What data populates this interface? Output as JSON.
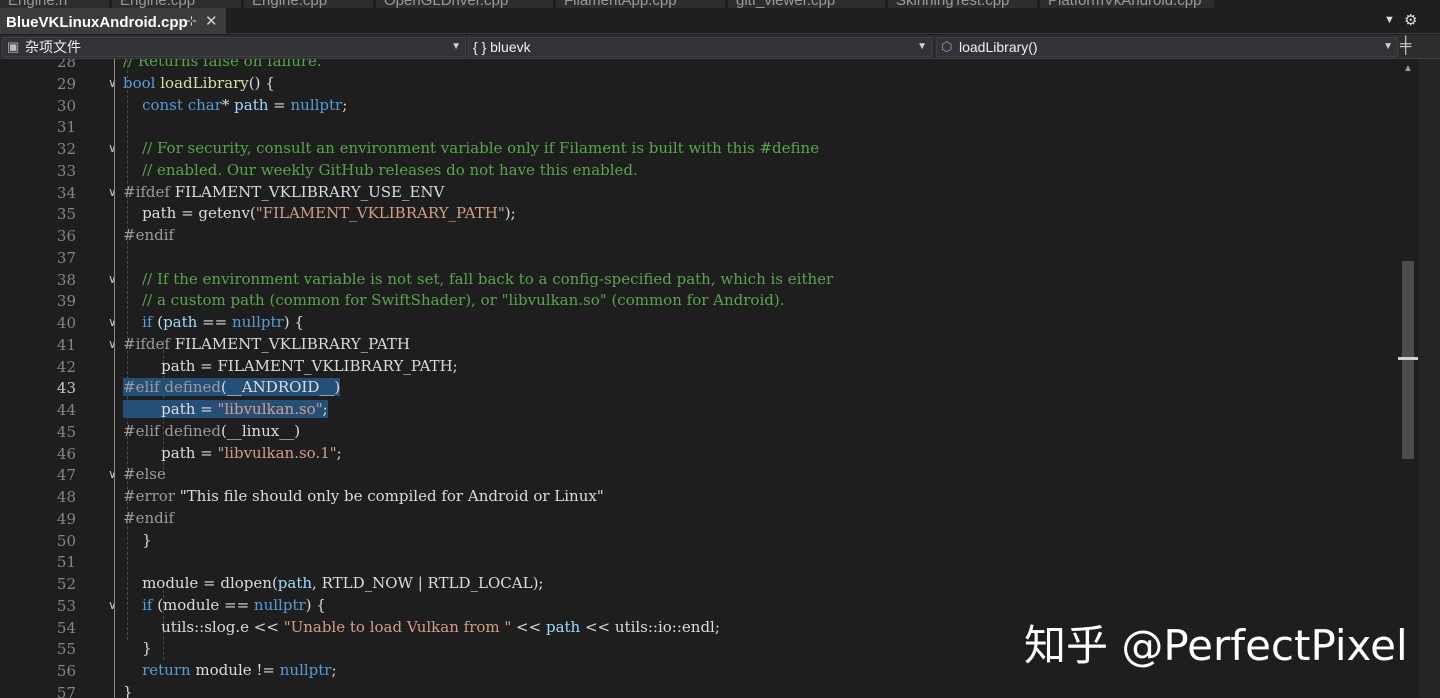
{
  "tabs": {
    "active": {
      "title": "BlueVKLinuxAndroid.cpp",
      "pin": "⊹",
      "close": "✕"
    },
    "inactive": [
      "Engine.h",
      "Engine.cpp",
      "Engine.cpp",
      "OpenGLDriver.cpp",
      "FilamentApp.cpp",
      "gltf_viewer.cpp",
      "SkinningTest.cpp",
      "PlatformVkAndroid.cpp"
    ]
  },
  "navbar": {
    "project": "杂项文件",
    "scope": "{ } bluevk",
    "member": "loadLibrary()"
  },
  "editor": {
    "current_line": 43,
    "lines": [
      {
        "n": "28",
        "html": "<span class='cm'>// Returns false on failure.</span>"
      },
      {
        "n": "29",
        "html": "<span class='kw'>bool</span> <span class='fn'>loadLibrary</span>() {"
      },
      {
        "n": "30",
        "html": "    <span class='kw'>const</span> <span class='kw'>char</span>* <span class='id'>path</span> = <span class='kw'>nullptr</span>;"
      },
      {
        "n": "31",
        "html": ""
      },
      {
        "n": "32",
        "html": "    <span class='cm'>// For security, consult an environment variable only if Filament is built with this #define</span>"
      },
      {
        "n": "33",
        "html": "    <span class='cm'>// enabled. Our weekly GitHub releases do not have this enabled.</span>"
      },
      {
        "n": "34",
        "html": "<span class='pp'>#ifdef</span> FILAMENT_VKLIBRARY_USE_ENV"
      },
      {
        "n": "35",
        "html": "    path = getenv(<span class='str'>\"FILAMENT_VKLIBRARY_PATH\"</span>);"
      },
      {
        "n": "36",
        "html": "<span class='pp'>#endif</span>"
      },
      {
        "n": "37",
        "html": ""
      },
      {
        "n": "38",
        "html": "    <span class='cm'>// If the environment variable is not set, fall back to a config-specified path, which is either</span>"
      },
      {
        "n": "39",
        "html": "    <span class='cm'>// a custom path (common for SwiftShader), or \"libvulkan.so\" (common for Android).</span>"
      },
      {
        "n": "40",
        "html": "    <span class='kw'>if</span> (<span class='id'>path</span> == <span class='kw'>nullptr</span>) {"
      },
      {
        "n": "41",
        "html": "<span class='pp'>#ifdef</span> FILAMENT_VKLIBRARY_PATH"
      },
      {
        "n": "42",
        "html": "        path = FILAMENT_VKLIBRARY_PATH;"
      },
      {
        "n": "43",
        "html": "<span class='sel'><span class='pp'>#elif defined</span>(__ANDROID__)</span>"
      },
      {
        "n": "44",
        "html": "<span class='sel'>        path = <span class='str'>\"libvulkan.so\"</span>;</span>"
      },
      {
        "n": "45",
        "html": "<span class='pp'>#elif defined</span>(__linux__)"
      },
      {
        "n": "46",
        "html": "        path = <span class='str'>\"libvulkan.so.1\"</span>;"
      },
      {
        "n": "47",
        "html": "<span class='pp'>#else</span>"
      },
      {
        "n": "48",
        "html": "<span class='pp'>#error</span> \"This file should only be compiled for Android or Linux\""
      },
      {
        "n": "49",
        "html": "<span class='pp'>#endif</span>"
      },
      {
        "n": "50",
        "html": "    }"
      },
      {
        "n": "51",
        "html": ""
      },
      {
        "n": "52",
        "html": "    module = dlopen(<span class='id'>path</span>, RTLD_NOW | RTLD_LOCAL);"
      },
      {
        "n": "53",
        "html": "    <span class='kw'>if</span> (module == <span class='kw'>nullptr</span>) {"
      },
      {
        "n": "54",
        "html": "        utils::slog.e &lt;&lt; <span class='str'>\"Unable to load Vulkan from \"</span> &lt;&lt; <span class='id'>path</span> &lt;&lt; utils::io::endl;"
      },
      {
        "n": "55",
        "html": "    }"
      },
      {
        "n": "56",
        "html": "    <span class='kw'>return</span> module != <span class='kw'>nullptr</span>;"
      },
      {
        "n": "57",
        "html": "}"
      }
    ]
  },
  "watermark": "知乎 @PerfectPixel",
  "colors": {
    "background": "#1e1e1e",
    "keyword": "#569cd6",
    "comment": "#57a64a",
    "string": "#d69d85",
    "selection": "#264f78"
  }
}
